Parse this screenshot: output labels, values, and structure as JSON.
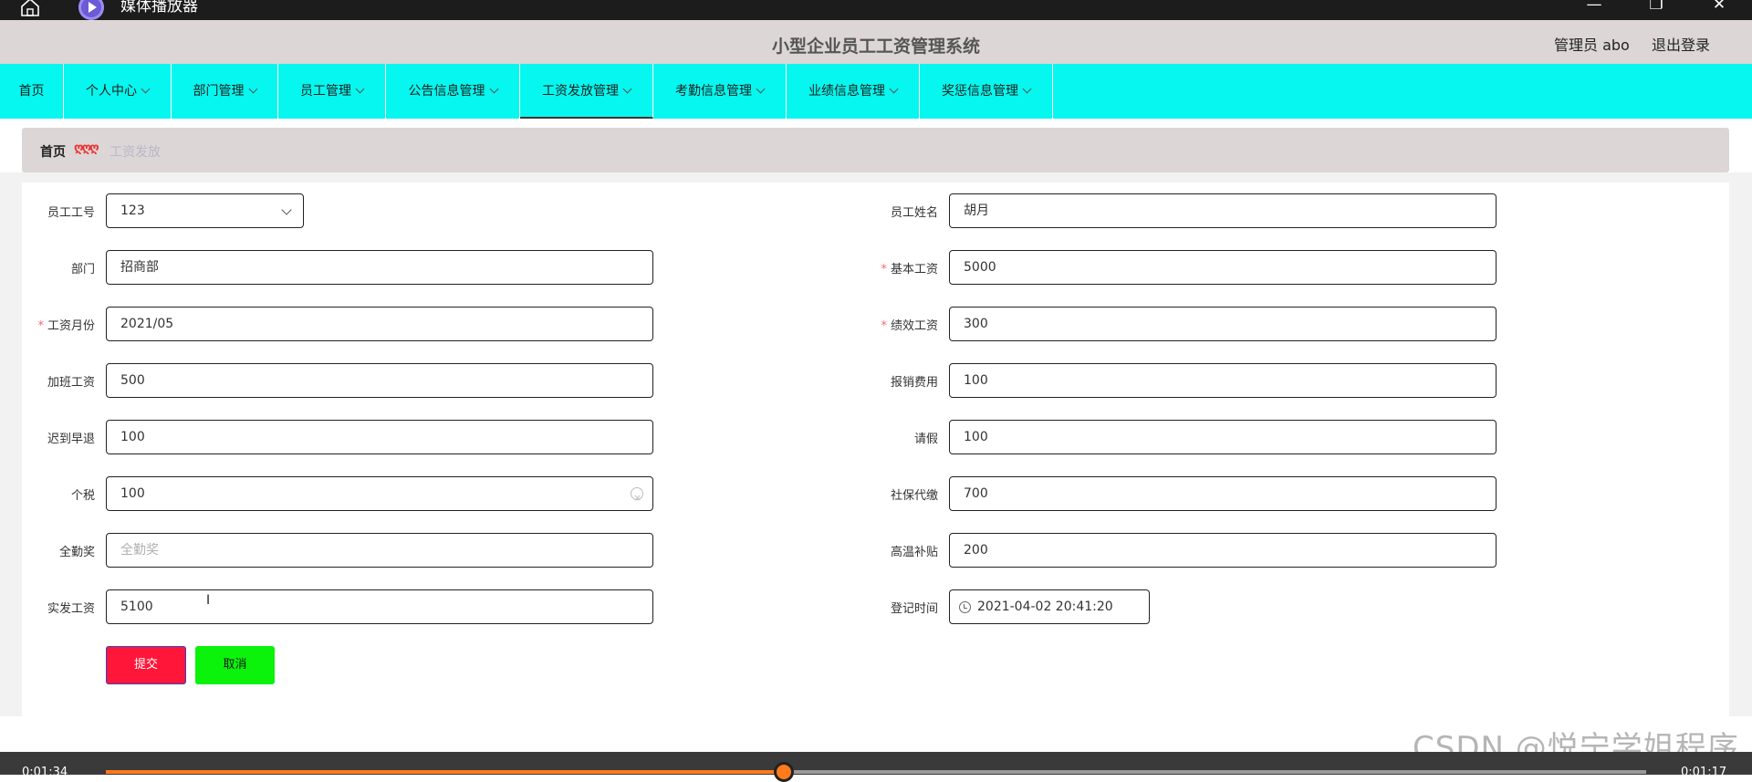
{
  "player": {
    "title": "媒体播放器",
    "time_elapsed": "0:01:34",
    "time_remaining": "0:01:17",
    "progress_fraction": 0.44
  },
  "header": {
    "title": "小型企业员工工资管理系统",
    "user": "管理员 abo",
    "logout": "退出登录"
  },
  "nav": {
    "items": [
      {
        "label": "首页"
      },
      {
        "label": "个人中心"
      },
      {
        "label": "部门管理"
      },
      {
        "label": "员工管理"
      },
      {
        "label": "公告信息管理"
      },
      {
        "label": "工资发放管理"
      },
      {
        "label": "考勤信息管理"
      },
      {
        "label": "业绩信息管理"
      },
      {
        "label": "奖惩信息管理"
      }
    ],
    "active_index": 5
  },
  "breadcrumb": {
    "home": "首页",
    "separator": "ღღღ",
    "current": "工资发放"
  },
  "form": {
    "employee_no": {
      "label": "员工工号",
      "value": "123"
    },
    "employee_name": {
      "label": "员工姓名",
      "value": "胡月"
    },
    "department": {
      "label": "部门",
      "value": "招商部"
    },
    "base_salary": {
      "label": "基本工资",
      "value": "5000"
    },
    "salary_month": {
      "label": "工资月份",
      "value": "2021/05"
    },
    "performance_salary": {
      "label": "绩效工资",
      "value": "300"
    },
    "overtime_pay": {
      "label": "加班工资",
      "value": "500"
    },
    "reimbursement": {
      "label": "报销费用",
      "value": "100"
    },
    "late_early": {
      "label": "迟到早退",
      "value": "100"
    },
    "leave": {
      "label": "请假",
      "value": "100"
    },
    "income_tax": {
      "label": "个税",
      "value": "100"
    },
    "social_security": {
      "label": "社保代缴",
      "value": "700"
    },
    "attendance_bonus": {
      "label": "全勤奖",
      "placeholder": "全勤奖"
    },
    "heat_allowance": {
      "label": "高温补贴",
      "value": "200"
    },
    "net_salary": {
      "label": "实发工资",
      "value": "5100"
    },
    "register_time": {
      "label": "登记时间",
      "value": "2021-04-02 20:41:20"
    },
    "required_mark": "*",
    "submit": "提交",
    "cancel": "取消"
  },
  "watermark": "CSDN @悦宁学姐程序"
}
